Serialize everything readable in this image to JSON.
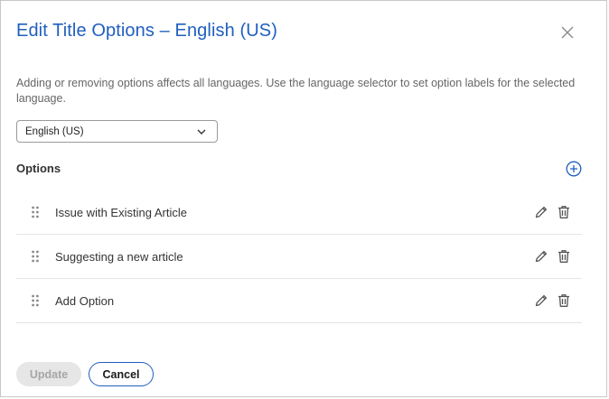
{
  "dialog": {
    "title": "Edit Title Options – English (US)",
    "description": "Adding or removing options affects all languages. Use the language selector to set option labels for the selected language.",
    "language_select": {
      "value": "English (US)"
    },
    "options_label": "Options",
    "options": [
      {
        "label": "Issue with Existing Article"
      },
      {
        "label": "Suggesting a new article"
      },
      {
        "label": "Add Option"
      }
    ],
    "buttons": {
      "update": "Update",
      "cancel": "Cancel"
    },
    "icons": {
      "close": "close-icon",
      "add": "plus-circle-icon",
      "drag": "drag-handle-icon",
      "edit": "pencil-icon",
      "delete": "trash-icon",
      "select": "chevron-down-icon"
    },
    "colors": {
      "accent": "#1f5fbf",
      "disabled_bg": "#e6e6e6",
      "disabled_text": "#a6a6a6"
    }
  }
}
